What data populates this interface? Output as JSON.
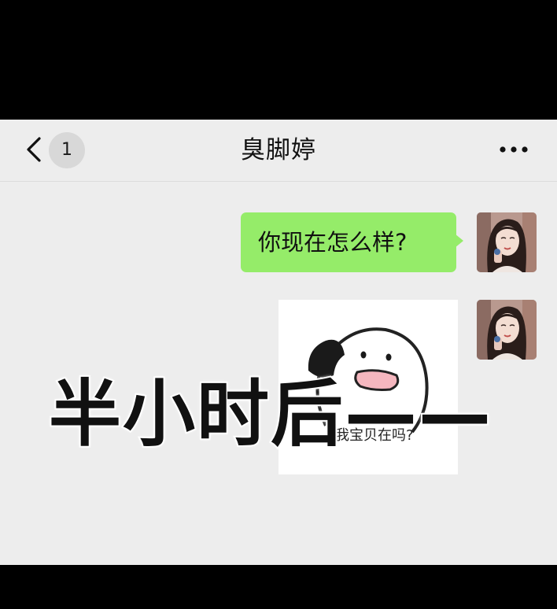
{
  "header": {
    "back_label": "‹",
    "unread_count": "1",
    "title": "臭脚婷",
    "more_label": "•••"
  },
  "messages": [
    {
      "type": "text",
      "text": "你现在怎么样?",
      "sender": "self"
    },
    {
      "type": "sticker",
      "sticker_text": "我宝贝在吗?",
      "sender": "self"
    }
  ],
  "overlay": {
    "caption": "半小时后——"
  },
  "colors": {
    "bubble_self": "#95ec69",
    "chat_background": "#ededed",
    "frame_background": "#000000"
  },
  "icons": {
    "back": "chevron-left-icon",
    "more": "more-horizontal-icon"
  }
}
